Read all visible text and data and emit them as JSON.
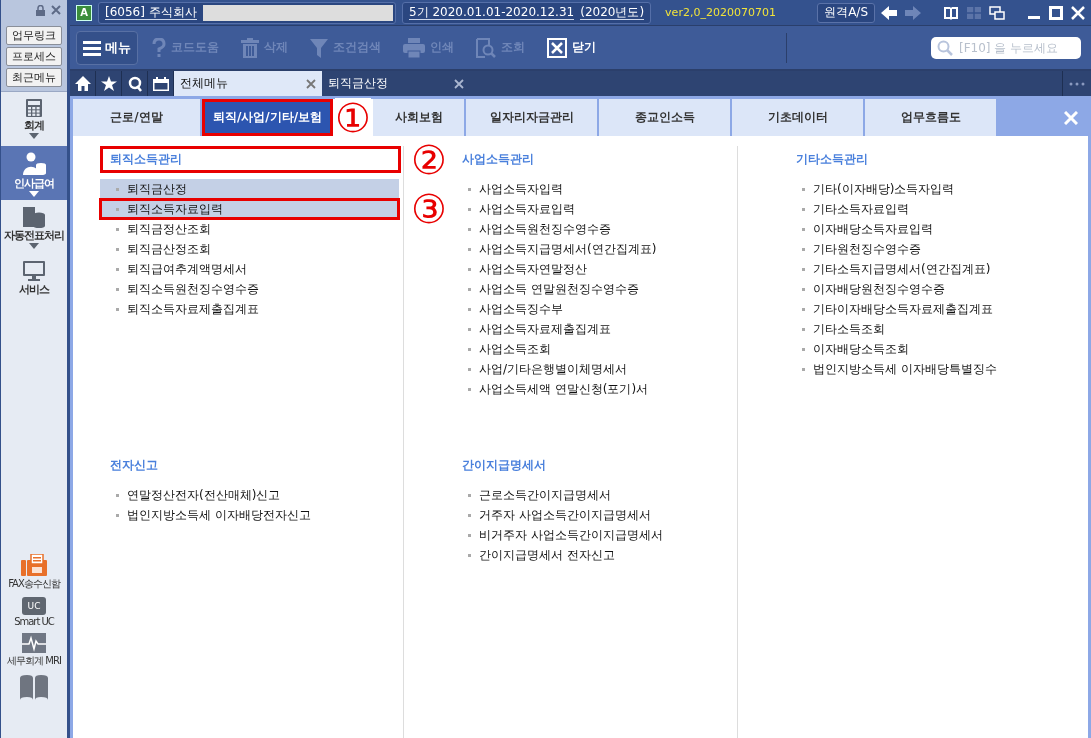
{
  "sidebar": {
    "quick_buttons": [
      "업무링크",
      "프로세스",
      "최근메뉴"
    ],
    "nav": [
      {
        "label": "회계",
        "selected": false,
        "has_submenu": true
      },
      {
        "label": "인사급여",
        "selected": true,
        "has_submenu": true
      },
      {
        "label": "자동전표처리",
        "selected": false,
        "has_submenu": true
      },
      {
        "label": "서비스",
        "selected": false,
        "has_submenu": false
      }
    ],
    "tools": [
      {
        "label": "FAX송수신함"
      },
      {
        "label": "Smart UC",
        "icon_text": "UC"
      },
      {
        "label": "세무회계 MRI"
      }
    ]
  },
  "title_bar": {
    "app_icon": "A",
    "company": "[6056] 주식회사",
    "period": "5기  2020.01.01-2020.12.31",
    "fiscal_year": "(2020년도)",
    "version": "ver2,0_2020070701",
    "remote_button": "원격A/S"
  },
  "toolbar": {
    "menu_button": "메뉴",
    "buttons": [
      {
        "label": "코드도움",
        "disabled": true
      },
      {
        "label": "삭제",
        "disabled": true
      },
      {
        "label": "조건검색",
        "disabled": true
      },
      {
        "label": "인쇄",
        "disabled": true
      },
      {
        "label": "조회",
        "disabled": true
      },
      {
        "label": "닫기",
        "disabled": false
      }
    ],
    "search": {
      "placeholder": "[F10] 을 누르세요"
    }
  },
  "tabs": [
    {
      "label": "전체메뉴",
      "selected": true
    },
    {
      "label": "퇴직금산정",
      "selected": false
    }
  ],
  "menu": {
    "categories": [
      {
        "label": "근로/연말",
        "selected": false
      },
      {
        "label": "퇴직/사업/기타/보험",
        "selected": true,
        "callout": "①"
      },
      {
        "label": "사회보험",
        "selected": false
      },
      {
        "label": "일자리자금관리",
        "selected": false
      },
      {
        "label": "종교인소득",
        "selected": false
      },
      {
        "label": "기초데이터",
        "selected": false
      },
      {
        "label": "업무흐름도",
        "selected": false
      }
    ],
    "sections": [
      {
        "title": "퇴직소득관리",
        "callout": "②",
        "items": [
          {
            "label": "퇴직금산정",
            "selected": true
          },
          {
            "label": "퇴직소득자료입력",
            "selected": true,
            "callout": "③"
          },
          {
            "label": "퇴직금정산조회",
            "selected": false
          },
          {
            "label": "퇴직금산정조회",
            "selected": false
          },
          {
            "label": "퇴직급여추계액명세서",
            "selected": false
          },
          {
            "label": "퇴직소득원천징수영수증",
            "selected": false
          },
          {
            "label": "퇴직소득자료제출집계표",
            "selected": false
          }
        ]
      },
      {
        "title": "사업소득관리",
        "items": [
          {
            "label": "사업소득자입력",
            "selected": false
          },
          {
            "label": "사업소득자료입력",
            "selected": false
          },
          {
            "label": "사업소득원천징수영수증",
            "selected": false
          },
          {
            "label": "사업소득지급명세서(연간집계표)",
            "selected": false
          },
          {
            "label": "사업소득자연말정산",
            "selected": false
          },
          {
            "label": "사업소득 연말원천징수영수증",
            "selected": false
          },
          {
            "label": "사업소득징수부",
            "selected": false
          },
          {
            "label": "사업소득자료제출집계표",
            "selected": false
          },
          {
            "label": "사업소득조회",
            "selected": false
          },
          {
            "label": "사업/기타은행별이체명세서",
            "selected": false
          },
          {
            "label": "사업소득세액 연말신청(포기)서",
            "selected": false
          }
        ]
      },
      {
        "title": "기타소득관리",
        "items": [
          {
            "label": "기타(이자배당)소득자입력",
            "selected": false
          },
          {
            "label": "기타소득자료입력",
            "selected": false
          },
          {
            "label": "이자배당소득자료입력",
            "selected": false
          },
          {
            "label": "기타원천징수영수증",
            "selected": false
          },
          {
            "label": "기타소득지급명세서(연간집계표)",
            "selected": false
          },
          {
            "label": "이자배당원천징수영수증",
            "selected": false
          },
          {
            "label": "기타이자배당소득자료제출집계표",
            "selected": false
          },
          {
            "label": "기타소득조회",
            "selected": false
          },
          {
            "label": "이자배당소득조회",
            "selected": false
          },
          {
            "label": "법인지방소득세 이자배당특별징수",
            "selected": false
          }
        ]
      },
      {
        "title": "전자신고",
        "items": [
          {
            "label": "연말정산전자(전산매체)신고",
            "selected": false
          },
          {
            "label": "법인지방소득세 이자배당전자신고",
            "selected": false
          }
        ]
      },
      {
        "title": "간이지급명세서",
        "items": [
          {
            "label": "근로소득간이지급명세서",
            "selected": false
          },
          {
            "label": "거주자 사업소득간이지급명세서",
            "selected": false
          },
          {
            "label": "비거주자 사업소득간이지급명세서",
            "selected": false
          },
          {
            "label": "간이지급명세서 전자신고",
            "selected": false
          }
        ]
      }
    ]
  }
}
